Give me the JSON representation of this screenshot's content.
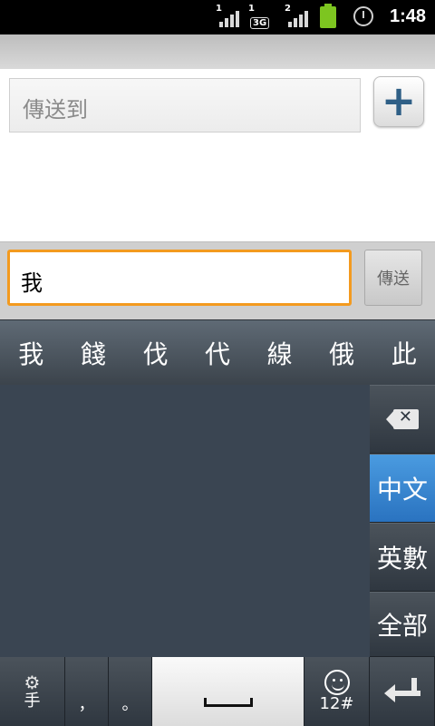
{
  "status_bar": {
    "time": "1:48",
    "signals": [
      {
        "index": "1",
        "kind": "signal-bars"
      },
      {
        "index": "1",
        "kind": "3g",
        "tag": "3G"
      },
      {
        "index": "2",
        "kind": "signal-bars"
      }
    ],
    "icons": [
      "battery-icon",
      "alarm-icon"
    ],
    "battery_color": "#7dc520"
  },
  "recipient": {
    "placeholder": "傳送到",
    "add_button_icon": "plus-icon"
  },
  "compose": {
    "value": "我",
    "send_label": "傳送",
    "accent_color": "#f39a1f"
  },
  "candidates": [
    "我",
    "餞",
    "伐",
    "代",
    "線",
    "俄",
    "此"
  ],
  "keyboard": {
    "right_keys": [
      {
        "label": "",
        "icon": "backspace-icon"
      },
      {
        "label": "中文",
        "active": true
      },
      {
        "label": "英數"
      },
      {
        "label": "全部"
      }
    ],
    "bottom_row": {
      "settings_icon": "gear-icon",
      "settings_label": "手",
      "comma": "，",
      "period": "。",
      "space_icon": "space-bar-icon",
      "symbols_label": "12#",
      "emoji_icon": "smiley-icon",
      "enter_icon": "enter-icon"
    },
    "active_color": "#2a73c0"
  }
}
